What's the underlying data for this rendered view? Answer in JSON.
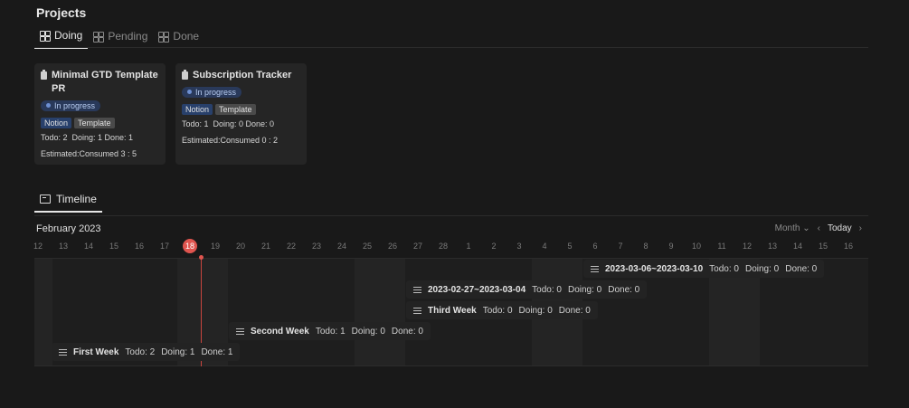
{
  "page": {
    "title": "Projects"
  },
  "tabs": [
    {
      "label": "Doing",
      "active": true
    },
    {
      "label": "Pending",
      "active": false
    },
    {
      "label": "Done",
      "active": false
    }
  ],
  "cards": [
    {
      "title_line1": "Minimal GTD Template",
      "title_line2": "PR",
      "status": "In progress",
      "tags": [
        "Notion",
        "Template"
      ],
      "counts": "Todo: 2  Doing: 1 Done: 1",
      "estimate": "Estimated:Consumed 3 : 5"
    },
    {
      "title_line1": "Subscription Tracker",
      "status": "In progress",
      "tags": [
        "Notion",
        "Template"
      ],
      "counts": "Todo: 1  Doing: 0 Done: 0",
      "estimate": "Estimated:Consumed 0 : 2"
    }
  ],
  "timeline": {
    "tab_label": "Timeline",
    "month_label": "February 2023",
    "view_select": "Month",
    "today_button": "Today",
    "days": [
      "12",
      "13",
      "14",
      "15",
      "16",
      "17",
      "18",
      "19",
      "20",
      "21",
      "22",
      "23",
      "24",
      "25",
      "26",
      "27",
      "28",
      "1",
      "2",
      "3",
      "4",
      "5",
      "6",
      "7",
      "8",
      "9",
      "10",
      "11",
      "12",
      "13",
      "14",
      "15",
      "16"
    ],
    "today": "18",
    "bars": [
      {
        "title": "2023-03-06~2023-03-10",
        "todo": "Todo: 0",
        "doing": "Doing: 0",
        "done": "Done: 0"
      },
      {
        "title": "2023-02-27~2023-03-04",
        "todo": "Todo: 0",
        "doing": "Doing: 0",
        "done": "Done: 0"
      },
      {
        "title": "Third Week",
        "todo": "Todo: 0",
        "doing": "Doing: 0",
        "done": "Done: 0"
      },
      {
        "title": "Second Week",
        "todo": "Todo: 1",
        "doing": "Doing: 0",
        "done": "Done: 0"
      },
      {
        "title": "First Week",
        "todo": "Todo: 2",
        "doing": "Doing: 1",
        "done": "Done: 1"
      }
    ]
  },
  "colors": {
    "background": "#191919",
    "today_marker": "#e0554f",
    "status_bg": "#29395a",
    "notion_tag": "#28406b"
  }
}
